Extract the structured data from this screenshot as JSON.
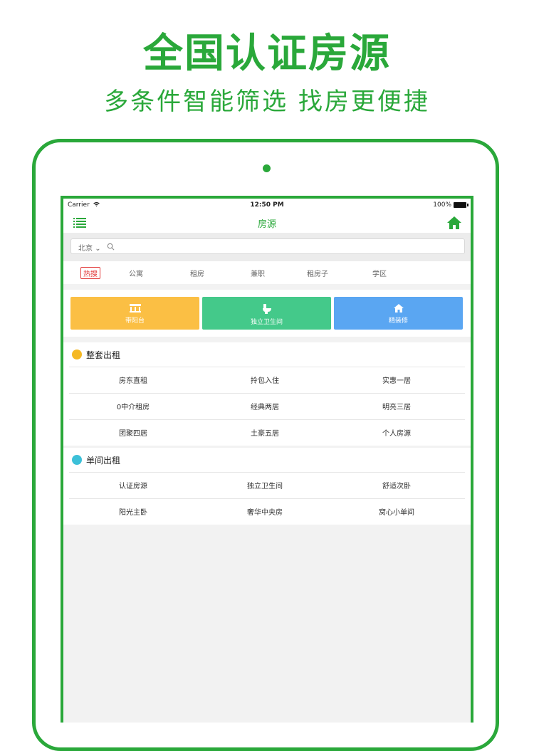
{
  "promo": {
    "headline": "全国认证房源",
    "subline": "多条件智能筛选  找房更便捷"
  },
  "status_bar": {
    "carrier": "Carrier",
    "time": "12:50 PM",
    "battery": "100%"
  },
  "nav": {
    "title": "房源",
    "left_icon": "list-menu-icon",
    "right_icon": "home-icon"
  },
  "search": {
    "city": "北京",
    "placeholder": ""
  },
  "tags": [
    "热搜",
    "公寓",
    "租房",
    "兼职",
    "租房子",
    "学区"
  ],
  "features": [
    {
      "label": "带阳台",
      "icon": "balcony-icon",
      "color": "#fbbf44"
    },
    {
      "label": "独立卫生间",
      "icon": "toilet-icon",
      "color": "#44c98a"
    },
    {
      "label": "精装修",
      "icon": "house-icon",
      "color": "#5aa6f2"
    }
  ],
  "sections": [
    {
      "title": "整套出租",
      "icon_color": "#f5b823",
      "rows": [
        [
          "房东直租",
          "拎包入住",
          "实惠一居"
        ],
        [
          "0中介租房",
          "经典两居",
          "明亮三居"
        ],
        [
          "团聚四居",
          "土豪五居",
          "个人房源"
        ]
      ]
    },
    {
      "title": "单间出租",
      "icon_color": "#3cc0d8",
      "rows": [
        [
          "认证房源",
          "独立卫生间",
          "舒适次卧"
        ],
        [
          "阳光主卧",
          "奢华中央房",
          "窝心小单间"
        ]
      ]
    }
  ],
  "colors": {
    "accent": "#2aa83a"
  }
}
